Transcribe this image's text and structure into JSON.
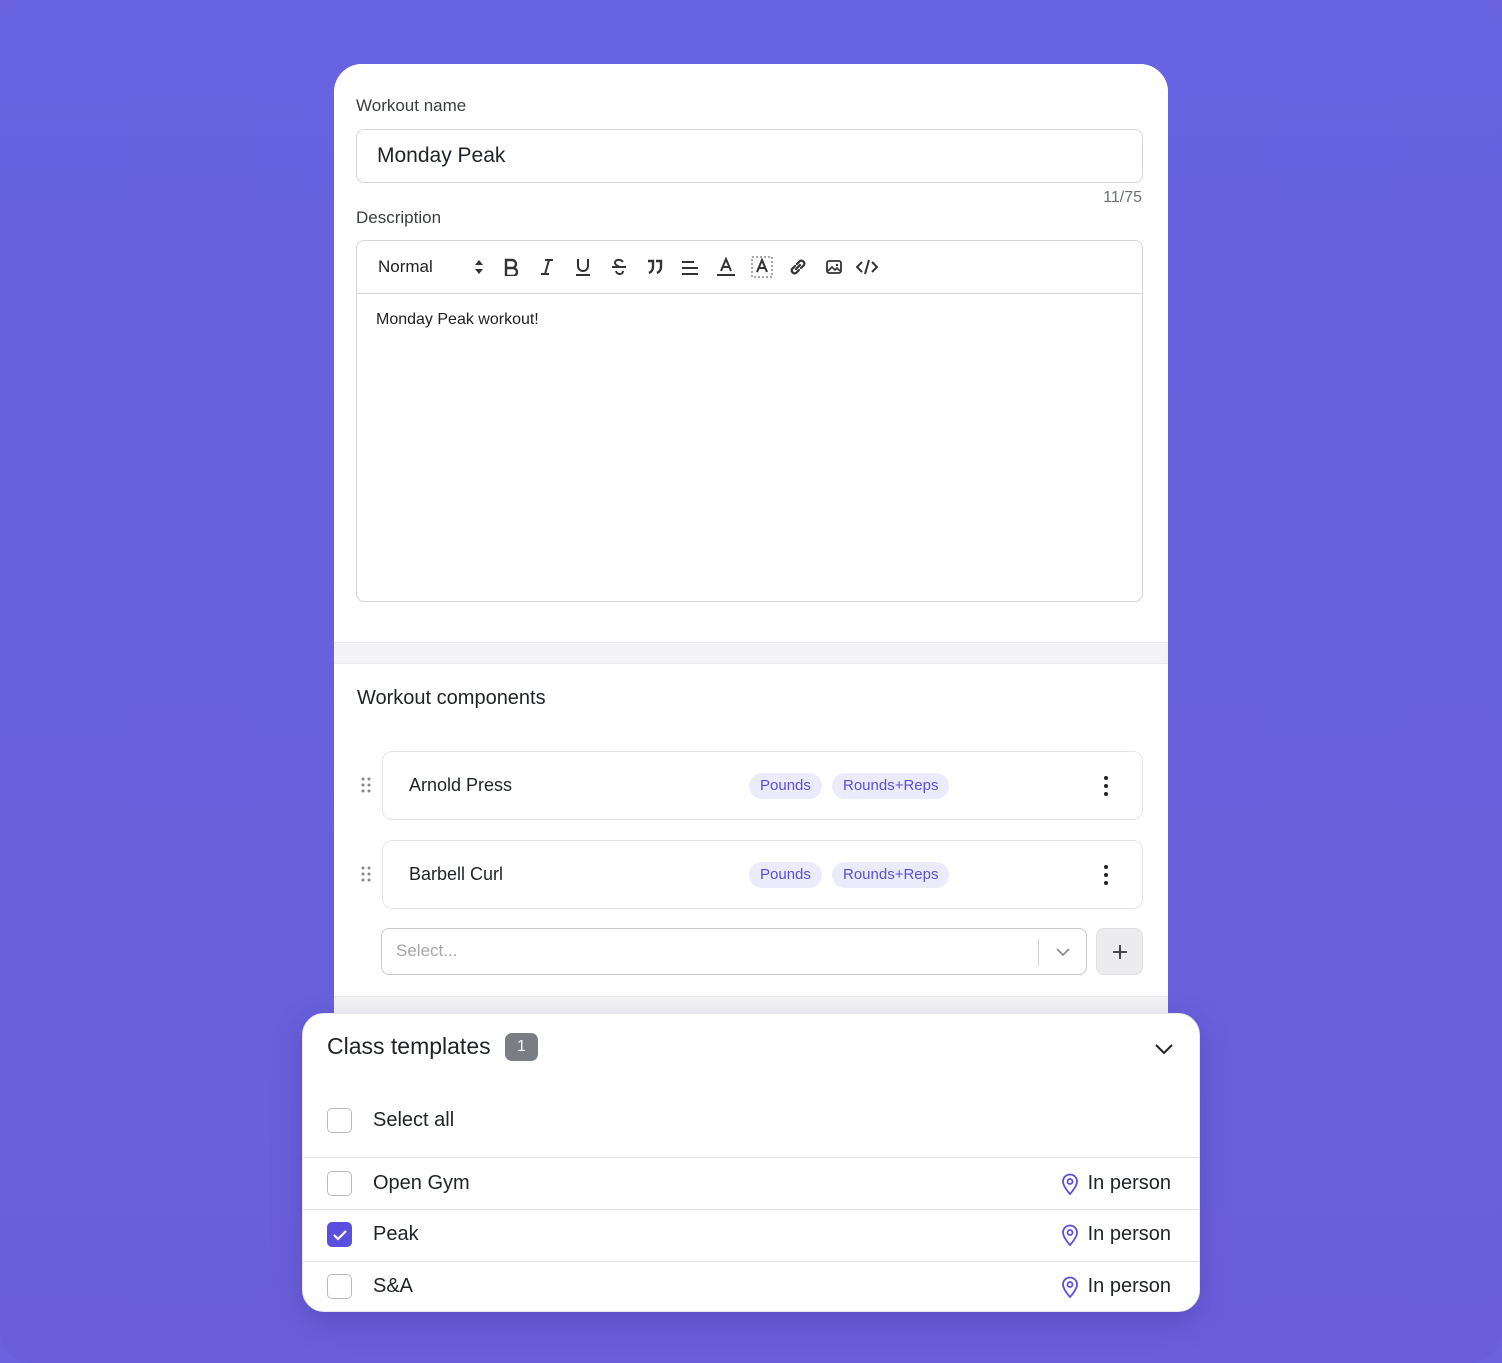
{
  "form": {
    "workout_name_label": "Workout name",
    "workout_name_value": "Monday Peak",
    "char_counter": "11/75",
    "description_label": "Description",
    "editor": {
      "format_select": "Normal",
      "body_text": "Monday Peak workout!",
      "toolbar_icons": [
        "bold-icon",
        "italic-icon",
        "underline-icon",
        "strikethrough-icon",
        "blockquote-icon",
        "align-icon",
        "text-color-icon",
        "highlight-icon",
        "link-icon",
        "image-icon",
        "code-icon"
      ]
    }
  },
  "components": {
    "title": "Workout components",
    "items": [
      {
        "name": "Arnold Press",
        "tags": [
          "Pounds",
          "Rounds+Reps"
        ]
      },
      {
        "name": "Barbell Curl",
        "tags": [
          "Pounds",
          "Rounds+Reps"
        ]
      }
    ],
    "select_placeholder": "Select...",
    "add_label": "+"
  },
  "class_templates": {
    "title": "Class templates",
    "count": "1",
    "select_all_label": "Select all",
    "rows": [
      {
        "name": "Open Gym",
        "location": "In person",
        "checked": false
      },
      {
        "name": "Peak",
        "location": "In person",
        "checked": true
      },
      {
        "name": "S&A",
        "location": "In person",
        "checked": false
      }
    ]
  },
  "colors": {
    "background": "#6a62df",
    "accent": "#5b4fe0",
    "tag_bg": "#ecebfb",
    "tag_text": "#5a4fd6"
  }
}
